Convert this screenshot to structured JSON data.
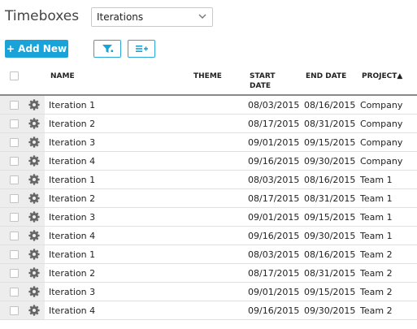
{
  "header": {
    "title": "Timeboxes",
    "type_select_value": "Iterations"
  },
  "toolbar": {
    "add_label": "+ Add New"
  },
  "grid": {
    "columns": {
      "name": "NAME",
      "theme": "THEME",
      "start_date_1": "START",
      "start_date_2": "DATE",
      "end_date": "END DATE",
      "project": "PROJECT"
    },
    "sort_indicator": "▲",
    "rows": [
      {
        "name": "Iteration 1",
        "theme": "",
        "start": "08/03/2015",
        "end": "08/16/2015",
        "project": "Company"
      },
      {
        "name": "Iteration 2",
        "theme": "",
        "start": "08/17/2015",
        "end": "08/31/2015",
        "project": "Company"
      },
      {
        "name": "Iteration 3",
        "theme": "",
        "start": "09/01/2015",
        "end": "09/15/2015",
        "project": "Company"
      },
      {
        "name": "Iteration 4",
        "theme": "",
        "start": "09/16/2015",
        "end": "09/30/2015",
        "project": "Company"
      },
      {
        "name": "Iteration 1",
        "theme": "",
        "start": "08/03/2015",
        "end": "08/16/2015",
        "project": "Team 1"
      },
      {
        "name": "Iteration 2",
        "theme": "",
        "start": "08/17/2015",
        "end": "08/31/2015",
        "project": "Team 1"
      },
      {
        "name": "Iteration 3",
        "theme": "",
        "start": "09/01/2015",
        "end": "09/15/2015",
        "project": "Team 1"
      },
      {
        "name": "Iteration 4",
        "theme": "",
        "start": "09/16/2015",
        "end": "09/30/2015",
        "project": "Team 1"
      },
      {
        "name": "Iteration 1",
        "theme": "",
        "start": "08/03/2015",
        "end": "08/16/2015",
        "project": "Team 2"
      },
      {
        "name": "Iteration 2",
        "theme": "",
        "start": "08/17/2015",
        "end": "08/31/2015",
        "project": "Team 2"
      },
      {
        "name": "Iteration 3",
        "theme": "",
        "start": "09/01/2015",
        "end": "09/15/2015",
        "project": "Team 2"
      },
      {
        "name": "Iteration 4",
        "theme": "",
        "start": "09/16/2015",
        "end": "09/30/2015",
        "project": "Team 2"
      }
    ]
  },
  "icons": {
    "type_select": "chevron-down-icon",
    "filter": "filter-icon",
    "column_chooser": "column-chooser-icon",
    "row_action": "gear-icon"
  },
  "colors": {
    "accent": "#1aa3d9",
    "header_rule": "#8a8a8a",
    "row_rail": "#ededed"
  }
}
